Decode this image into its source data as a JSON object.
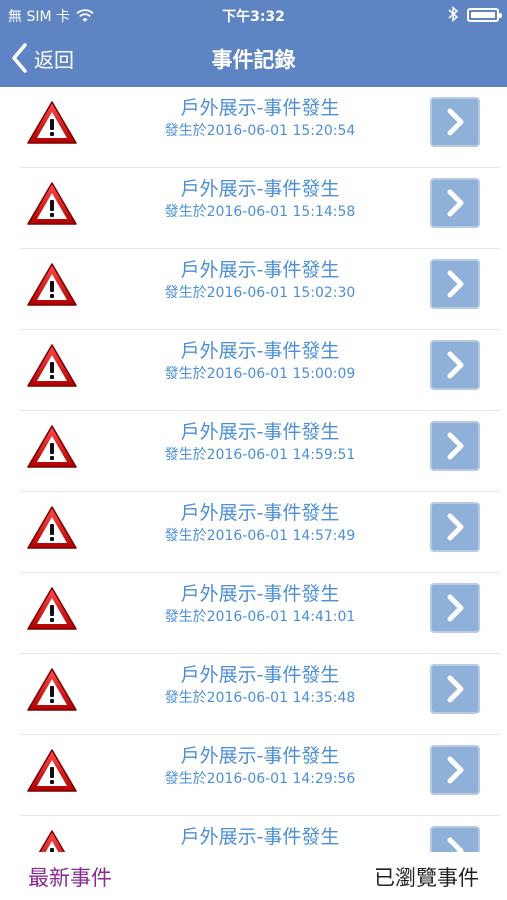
{
  "status_bar": {
    "carrier": "無 SIM 卡",
    "time": "下午3:32"
  },
  "nav": {
    "back_label": "返回",
    "title": "事件記錄"
  },
  "events": [
    {
      "title": "戶外展示-事件發生",
      "time": "發生於2016-06-01 15:20:54"
    },
    {
      "title": "戶外展示-事件發生",
      "time": "發生於2016-06-01 15:14:58"
    },
    {
      "title": "戶外展示-事件發生",
      "time": "發生於2016-06-01 15:02:30"
    },
    {
      "title": "戶外展示-事件發生",
      "time": "發生於2016-06-01 15:00:09"
    },
    {
      "title": "戶外展示-事件發生",
      "time": "發生於2016-06-01 14:59:51"
    },
    {
      "title": "戶外展示-事件發生",
      "time": "發生於2016-06-01 14:57:49"
    },
    {
      "title": "戶外展示-事件發生",
      "time": "發生於2016-06-01 14:41:01"
    },
    {
      "title": "戶外展示-事件發生",
      "time": "發生於2016-06-01 14:35:48"
    },
    {
      "title": "戶外展示-事件發生",
      "time": "發生於2016-06-01 14:29:56"
    },
    {
      "title": "戶外展示-事件發生",
      "time": ""
    }
  ],
  "footer": {
    "latest_label": "最新事件",
    "viewed_label": "已瀏覽事件"
  },
  "colors": {
    "nav_bar": "#5f84c4",
    "event_text": "#4c8fd8",
    "detail_button": "#8fb0d8",
    "latest_tab": "#8a2b93"
  },
  "icons": {
    "status": [
      "wifi-icon",
      "bluetooth-icon",
      "battery-icon"
    ],
    "nav": "chevron-left-icon",
    "row_leading": "warning-icon",
    "row_trailing": "chevron-right-icon"
  }
}
